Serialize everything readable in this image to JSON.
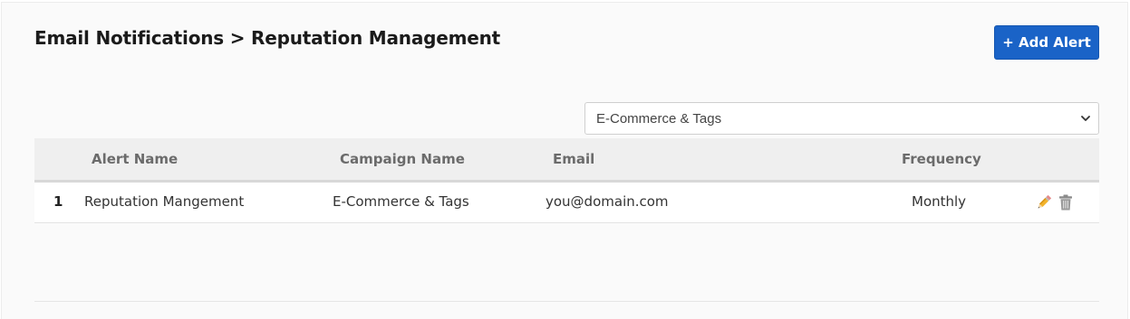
{
  "page": {
    "title": "Email Notifications > Reputation Management"
  },
  "toolbar": {
    "add_label": "+ Add Alert"
  },
  "campaign_filter": {
    "selected": "E-Commerce & Tags"
  },
  "table": {
    "columns": {
      "alert_name": "Alert Name",
      "campaign_name": "Campaign Name",
      "email": "Email",
      "frequency": "Frequency"
    },
    "rows": [
      {
        "num": "1",
        "alert_name": "Reputation Mangement",
        "campaign_name": "E-Commerce & Tags",
        "email": "you@domain.com",
        "frequency": "Monthly",
        "actions": [
          "edit-pencil-icon",
          "delete-trash-icon"
        ]
      }
    ]
  },
  "colors": {
    "primary": "#1a63c7",
    "header_bg": "#efefef"
  }
}
